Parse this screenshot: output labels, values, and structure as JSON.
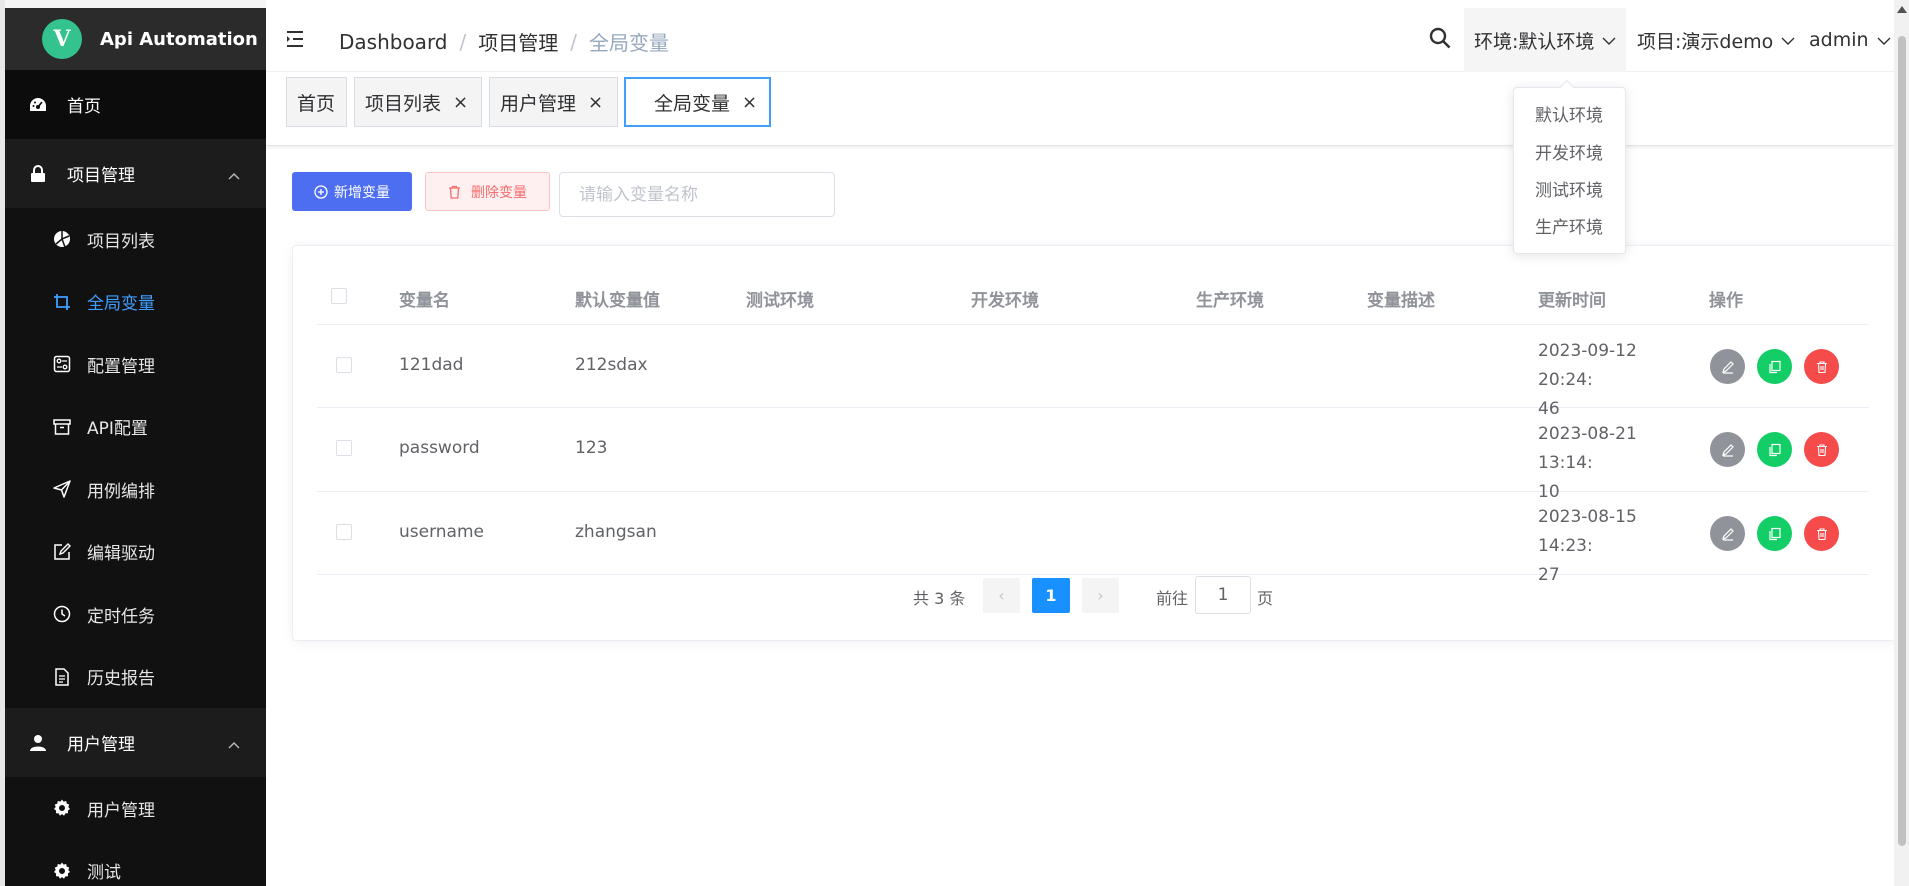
{
  "app": {
    "name": "Api Automation",
    "logo_letter": "V"
  },
  "sidebar": {
    "home": "首页",
    "groups": [
      {
        "label": "项目管理",
        "items": [
          "项目列表",
          "全局变量",
          "配置管理",
          "API配置",
          "用例编排",
          "编辑驱动",
          "定时任务",
          "历史报告"
        ]
      },
      {
        "label": "用户管理",
        "items": [
          "用户管理",
          "测试"
        ]
      }
    ],
    "active_item": "全局变量"
  },
  "header": {
    "breadcrumb": [
      "Dashboard",
      "项目管理",
      "全局变量"
    ],
    "env": "环境:默认环境",
    "project": "项目:演示demo",
    "user": "admin"
  },
  "tags": [
    "首页",
    "项目列表",
    "用户管理",
    "全局变量"
  ],
  "toolbar": {
    "add": "新增变量",
    "delete": "删除变量",
    "search_placeholder": "请输入变量名称"
  },
  "table": {
    "headers": [
      "变量名",
      "默认变量值",
      "测试环境",
      "开发环境",
      "生产环境",
      "变量描述",
      "更新时间",
      "操作"
    ],
    "rows": [
      {
        "name": "121dad",
        "value": "212sdax",
        "time1": "2023-09-12 20:24:",
        "time2": "46"
      },
      {
        "name": "password",
        "value": "123",
        "time1": "2023-08-21 13:14:",
        "time2": "10"
      },
      {
        "name": "username",
        "value": "zhangsan",
        "time1": "2023-08-15 14:23:",
        "time2": "27"
      }
    ]
  },
  "pagination": {
    "total": "共 3 条",
    "current": "1",
    "goto_label": "前往",
    "goto_value": "1",
    "page_suffix": "页",
    "prev": "‹",
    "next": "›"
  },
  "env_dropdown": [
    "默认环境",
    "开发环境",
    "测试环境",
    "生产环境"
  ],
  "colors": {
    "primary": "#409eff",
    "add_button": "#4e6ef2",
    "danger": "#f56c6c",
    "success": "#13ce66",
    "sidebar_bg": "#0c0c0c"
  }
}
